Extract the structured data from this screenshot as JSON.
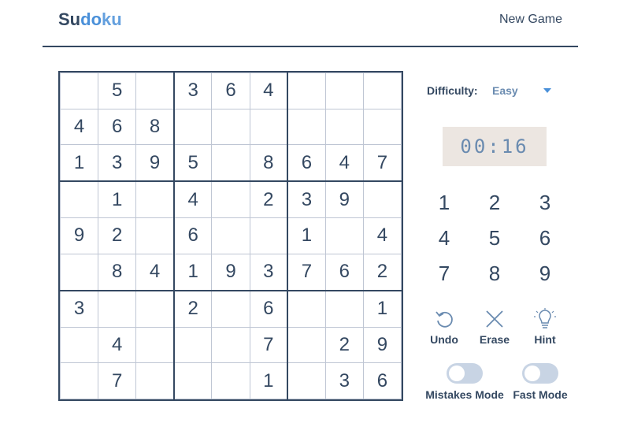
{
  "header": {
    "logo_su": "Su",
    "logo_do": "do",
    "logo_ku": "ku",
    "new_game": "New Game"
  },
  "board": {
    "rows": [
      [
        "",
        "5",
        "",
        "3",
        "6",
        "4",
        "",
        "",
        ""
      ],
      [
        "4",
        "6",
        "8",
        "",
        "",
        "",
        "",
        "",
        ""
      ],
      [
        "1",
        "3",
        "9",
        "5",
        "",
        "8",
        "6",
        "4",
        "7"
      ],
      [
        "",
        "1",
        "",
        "4",
        "",
        "2",
        "3",
        "9",
        ""
      ],
      [
        "9",
        "2",
        "",
        "6",
        "",
        "",
        "1",
        "",
        "4"
      ],
      [
        "",
        "8",
        "4",
        "1",
        "9",
        "3",
        "7",
        "6",
        "2"
      ],
      [
        "3",
        "",
        "",
        "2",
        "",
        "6",
        "",
        "",
        "1"
      ],
      [
        "",
        "4",
        "",
        "",
        "",
        "7",
        "",
        "2",
        "9"
      ],
      [
        "",
        "7",
        "",
        "",
        "",
        "1",
        "",
        "3",
        "6"
      ]
    ]
  },
  "difficulty": {
    "label": "Difficulty:",
    "value": "Easy"
  },
  "timer": "00:16",
  "numpad": [
    "1",
    "2",
    "3",
    "4",
    "5",
    "6",
    "7",
    "8",
    "9"
  ],
  "tools": {
    "undo": "Undo",
    "erase": "Erase",
    "hint": "Hint"
  },
  "toggles": {
    "mistakes_mode": "Mistakes Mode",
    "fast_mode": "Fast Mode",
    "mistakes_on": false,
    "fast_on": false
  },
  "colors": {
    "primary": "#344861",
    "accent": "#4a90d9",
    "timer_bg": "#ece6e1",
    "toggle_off": "#c8d4e4"
  },
  "icons": {
    "undo": "undo-icon",
    "erase": "x-icon",
    "hint": "lightbulb-icon",
    "caret": "caret-down-icon"
  }
}
